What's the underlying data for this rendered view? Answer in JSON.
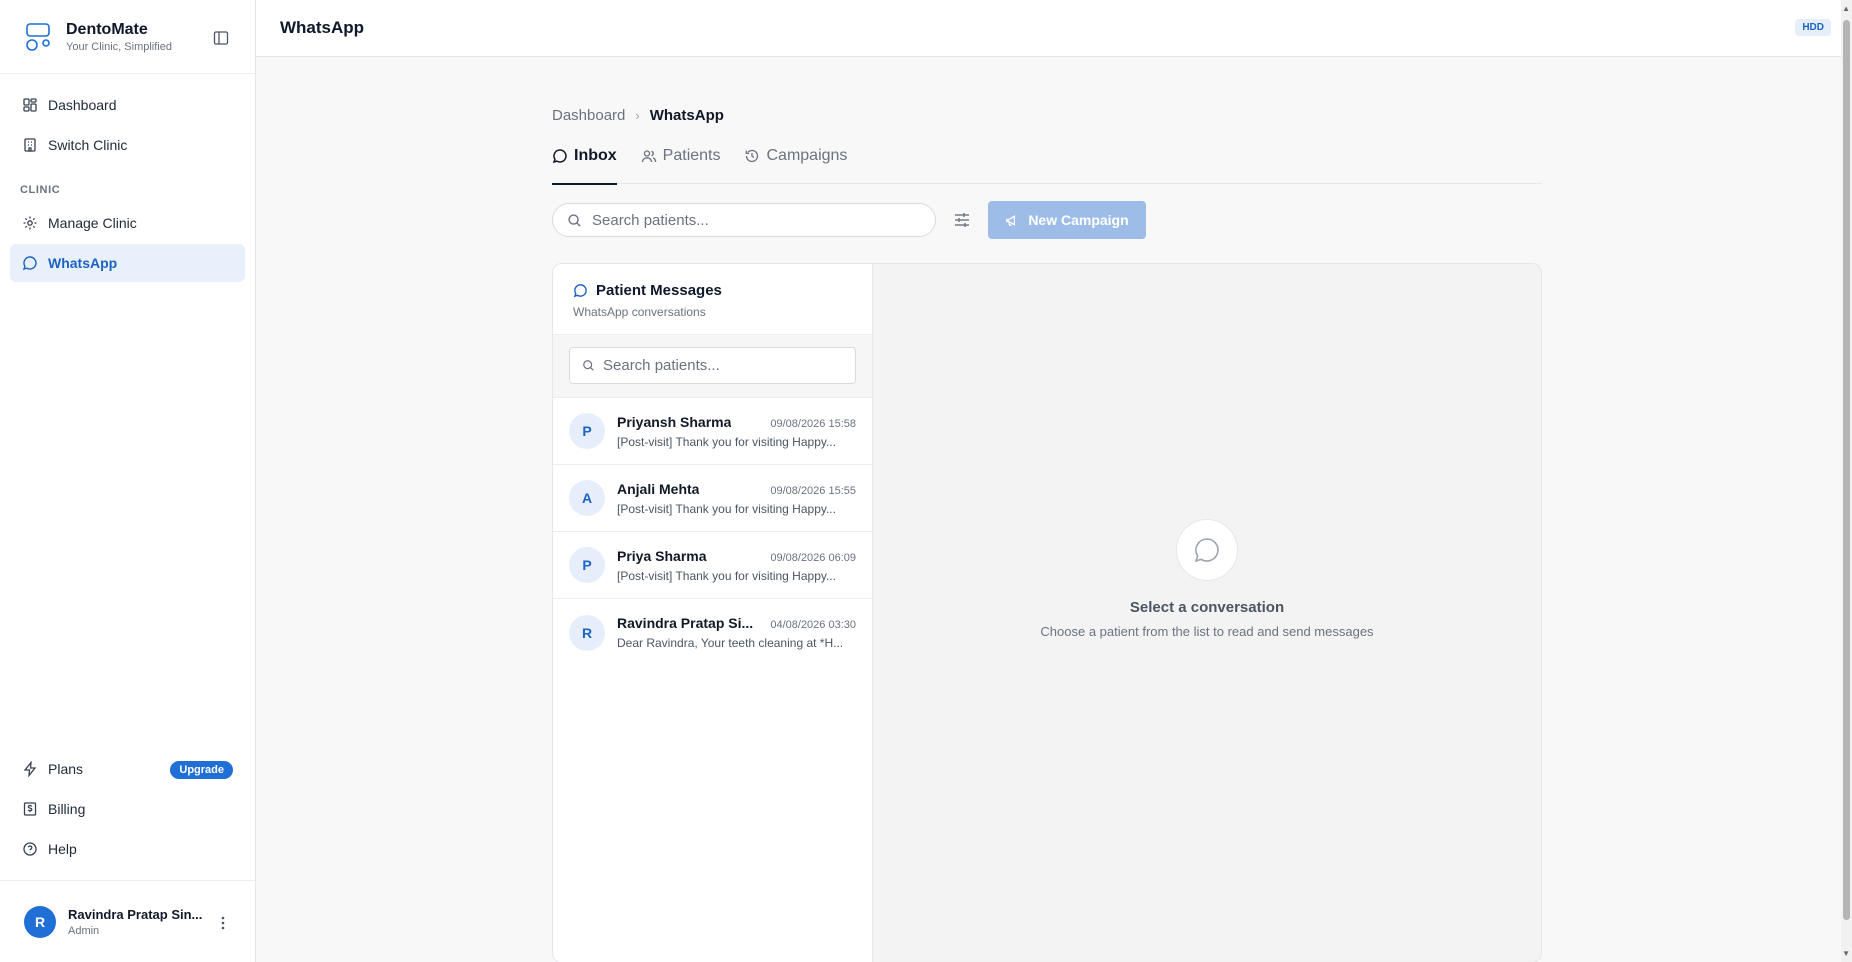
{
  "brand": {
    "name": "DentoMate",
    "tagline": "Your Clinic, Simplified"
  },
  "sidebar": {
    "top_items": [
      {
        "label": "Dashboard",
        "icon": "dashboard-icon"
      },
      {
        "label": "Switch Clinic",
        "icon": "building-icon"
      }
    ],
    "section_label": "CLINIC",
    "clinic_items": [
      {
        "label": "Manage Clinic",
        "icon": "gear-icon"
      },
      {
        "label": "WhatsApp",
        "icon": "chat-icon",
        "active": true
      }
    ],
    "bottom_items": [
      {
        "label": "Plans",
        "icon": "lightning-icon",
        "badge": "Upgrade"
      },
      {
        "label": "Billing",
        "icon": "billing-icon"
      },
      {
        "label": "Help",
        "icon": "help-icon"
      }
    ]
  },
  "user": {
    "initial": "R",
    "name": "Ravindra Pratap Sin...",
    "role": "Admin"
  },
  "header": {
    "title": "WhatsApp",
    "badge": "HDD"
  },
  "breadcrumb": {
    "root": "Dashboard",
    "separator": "›",
    "current": "WhatsApp"
  },
  "tabs": [
    {
      "label": "Inbox",
      "icon": "chat-icon",
      "active": true
    },
    {
      "label": "Patients",
      "icon": "users-icon"
    },
    {
      "label": "Campaigns",
      "icon": "history-icon"
    }
  ],
  "toolbar": {
    "search_placeholder": "Search patients...",
    "new_campaign_label": "New Campaign"
  },
  "messages_panel": {
    "title": "Patient Messages",
    "subtitle": "WhatsApp conversations",
    "search_placeholder": "Search patients...",
    "conversations": [
      {
        "initial": "P",
        "name": "Priyansh Sharma",
        "time": "09/08/2026 15:58",
        "preview": "[Post-visit] Thank you for visiting Happy..."
      },
      {
        "initial": "A",
        "name": "Anjali Mehta",
        "time": "09/08/2026 15:55",
        "preview": "[Post-visit] Thank you for visiting Happy..."
      },
      {
        "initial": "P",
        "name": "Priya Sharma",
        "time": "09/08/2026 06:09",
        "preview": "[Post-visit] Thank you for visiting Happy..."
      },
      {
        "initial": "R",
        "name": "Ravindra Pratap Si...",
        "time": "04/08/2026 03:30",
        "preview": "Dear Ravindra, Your teeth cleaning at *H..."
      }
    ]
  },
  "empty_state": {
    "title": "Select a conversation",
    "subtitle": "Choose a patient from the list to read and send messages"
  },
  "colors": {
    "primary": "#1f6fd6",
    "active_bg": "#e8f0fb",
    "button_disabled": "#9dbde8"
  }
}
